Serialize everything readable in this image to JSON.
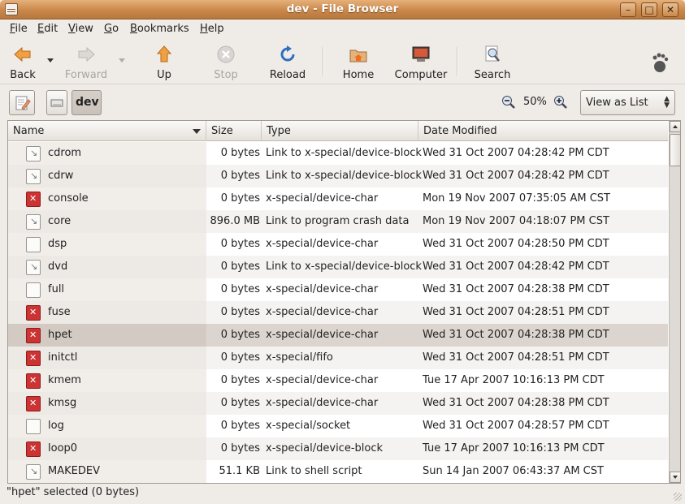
{
  "window": {
    "title": "dev - File Browser"
  },
  "menu": [
    {
      "label": "File",
      "u": "F",
      "rest": "ile"
    },
    {
      "label": "Edit",
      "u": "E",
      "rest": "dit"
    },
    {
      "label": "View",
      "u": "V",
      "rest": "iew"
    },
    {
      "label": "Go",
      "u": "G",
      "rest": "o"
    },
    {
      "label": "Bookmarks",
      "u": "B",
      "rest": "ookmarks"
    },
    {
      "label": "Help",
      "u": "H",
      "rest": "elp"
    }
  ],
  "toolbar": {
    "back": "Back",
    "forward": "Forward",
    "up": "Up",
    "stop": "Stop",
    "reload": "Reload",
    "home": "Home",
    "computer": "Computer",
    "search": "Search"
  },
  "location": {
    "path_button": "dev",
    "zoom": "50%",
    "view_mode": "View as List"
  },
  "columns": {
    "name": "Name",
    "size": "Size",
    "type": "Type",
    "date": "Date Modified"
  },
  "files": [
    {
      "name": "cdrom",
      "size": "0 bytes",
      "type": "Link to x-special/device-block",
      "date": "Wed 31 Oct 2007 04:28:42 PM CDT",
      "icon": "link-icon"
    },
    {
      "name": "cdrw",
      "size": "0 bytes",
      "type": "Link to x-special/device-block",
      "date": "Wed 31 Oct 2007 04:28:42 PM CDT",
      "icon": "link-icon"
    },
    {
      "name": "console",
      "size": "0 bytes",
      "type": "x-special/device-char",
      "date": "Mon 19 Nov 2007 07:35:05 AM CST",
      "icon": "error-icon"
    },
    {
      "name": "core",
      "size": "896.0 MB",
      "type": "Link to program crash data",
      "date": "Mon 19 Nov 2007 04:18:07 PM CST",
      "icon": "link-icon"
    },
    {
      "name": "dsp",
      "size": "0 bytes",
      "type": "x-special/device-char",
      "date": "Wed 31 Oct 2007 04:28:50 PM CDT",
      "icon": "file-icon"
    },
    {
      "name": "dvd",
      "size": "0 bytes",
      "type": "Link to x-special/device-block",
      "date": "Wed 31 Oct 2007 04:28:42 PM CDT",
      "icon": "link-icon"
    },
    {
      "name": "full",
      "size": "0 bytes",
      "type": "x-special/device-char",
      "date": "Wed 31 Oct 2007 04:28:38 PM CDT",
      "icon": "file-icon"
    },
    {
      "name": "fuse",
      "size": "0 bytes",
      "type": "x-special/device-char",
      "date": "Wed 31 Oct 2007 04:28:51 PM CDT",
      "icon": "error-icon"
    },
    {
      "name": "hpet",
      "size": "0 bytes",
      "type": "x-special/device-char",
      "date": "Wed 31 Oct 2007 04:28:38 PM CDT",
      "icon": "error-icon",
      "selected": true
    },
    {
      "name": "initctl",
      "size": "0 bytes",
      "type": "x-special/fifo",
      "date": "Wed 31 Oct 2007 04:28:51 PM CDT",
      "icon": "error-icon"
    },
    {
      "name": "kmem",
      "size": "0 bytes",
      "type": "x-special/device-char",
      "date": "Tue 17 Apr 2007 10:16:13 PM CDT",
      "icon": "error-icon"
    },
    {
      "name": "kmsg",
      "size": "0 bytes",
      "type": "x-special/device-char",
      "date": "Wed 31 Oct 2007 04:28:38 PM CDT",
      "icon": "error-icon"
    },
    {
      "name": "log",
      "size": "0 bytes",
      "type": "x-special/socket",
      "date": "Wed 31 Oct 2007 04:28:57 PM CDT",
      "icon": "file-icon"
    },
    {
      "name": "loop0",
      "size": "0 bytes",
      "type": "x-special/device-block",
      "date": "Tue 17 Apr 2007 10:16:13 PM CDT",
      "icon": "error-icon"
    },
    {
      "name": "MAKEDEV",
      "size": "51.1 KB",
      "type": "Link to shell script",
      "date": "Sun 14 Jan 2007 06:43:37 AM CST",
      "icon": "link-icon"
    }
  ],
  "status": "\"hpet\" selected (0 bytes)",
  "colors": {
    "titlebar": "#c9884a",
    "selected_row": "#dcd5cf",
    "error_icon": "#cc3333"
  }
}
